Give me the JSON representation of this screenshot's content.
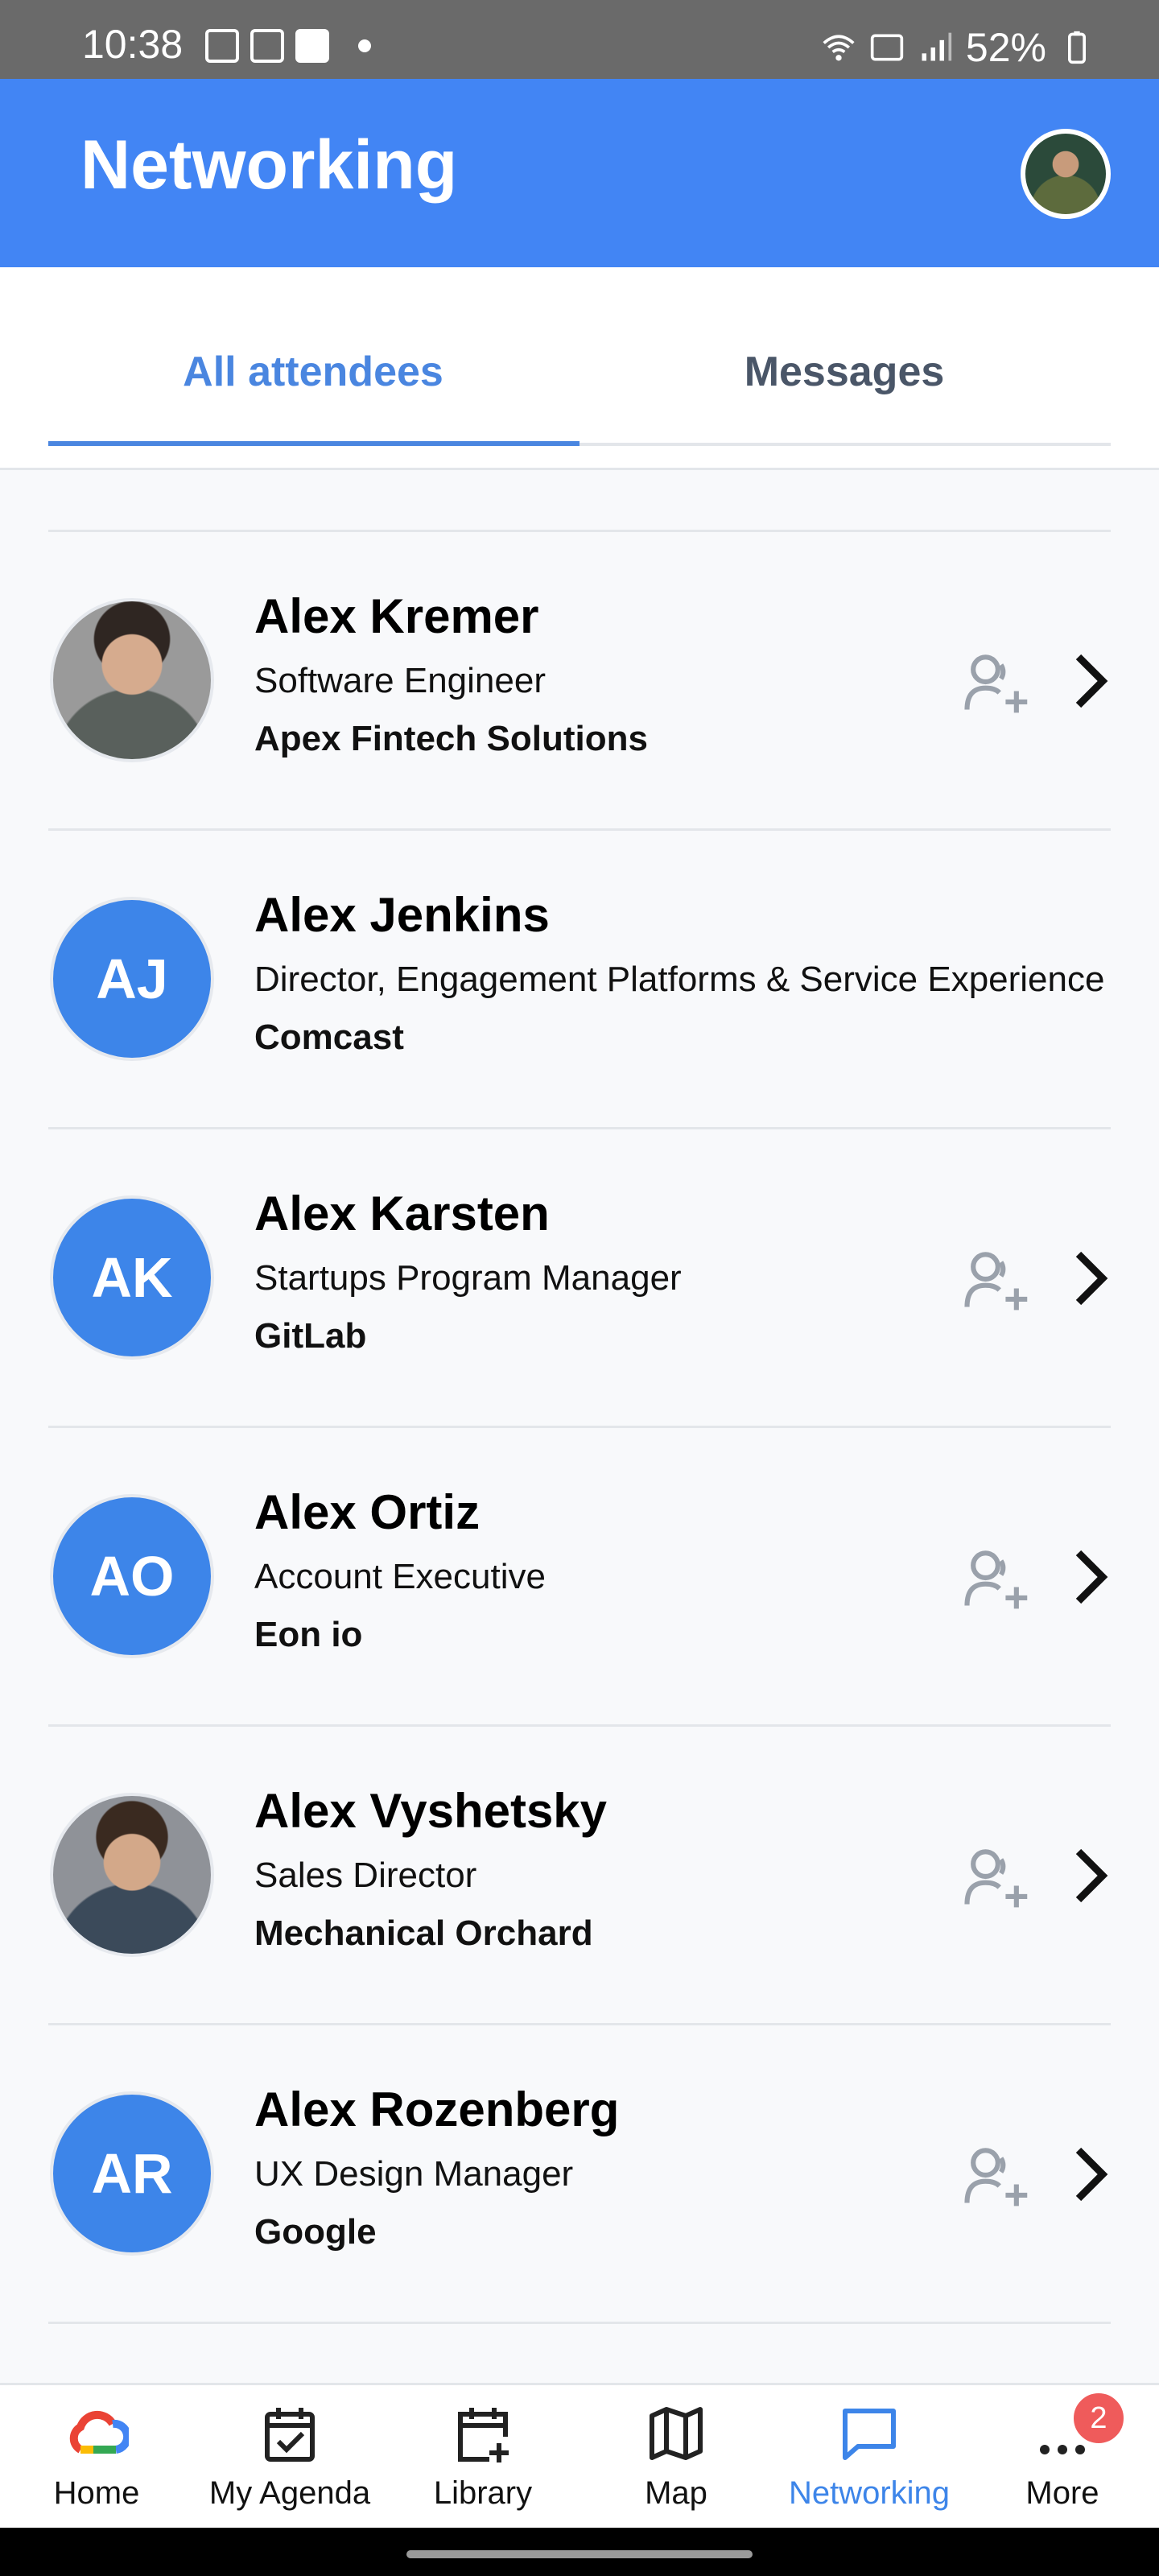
{
  "status_bar": {
    "time": "10:38",
    "battery": "52%"
  },
  "header": {
    "title": "Networking"
  },
  "tabs": [
    {
      "label": "All attendees",
      "active": true
    },
    {
      "label": "Messages",
      "active": false
    }
  ],
  "attendees": [
    {
      "name": "Alex Kremer",
      "title": "Software Engineer",
      "company": "Apex Fintech Solutions",
      "initials": "",
      "has_photo": true,
      "can_connect": true
    },
    {
      "name": "Alex Jenkins",
      "title": "Director, Engagement Platforms & Service Experience",
      "company": "Comcast",
      "initials": "AJ",
      "has_photo": false,
      "can_connect": false
    },
    {
      "name": "Alex Karsten",
      "title": "Startups Program Manager",
      "company": "GitLab",
      "initials": "AK",
      "has_photo": false,
      "can_connect": true
    },
    {
      "name": "Alex Ortiz",
      "title": "Account Executive",
      "company": "Eon io",
      "initials": "AO",
      "has_photo": false,
      "can_connect": true
    },
    {
      "name": "Alex Vyshetsky",
      "title": "Sales Director",
      "company": "Mechanical Orchard",
      "initials": "",
      "has_photo": true,
      "can_connect": true
    },
    {
      "name": "Alex Rozenberg",
      "title": "UX Design Manager",
      "company": "Google",
      "initials": "AR",
      "has_photo": false,
      "can_connect": true
    }
  ],
  "bottom_nav": [
    {
      "label": "Home",
      "icon": "google-cloud-icon",
      "active": false
    },
    {
      "label": "My Agenda",
      "icon": "calendar-check-icon",
      "active": false
    },
    {
      "label": "Library",
      "icon": "calendar-add-icon",
      "active": false
    },
    {
      "label": "Map",
      "icon": "map-icon",
      "active": false
    },
    {
      "label": "Networking",
      "icon": "chat-icon",
      "active": true
    },
    {
      "label": "More",
      "icon": "more-dots-icon",
      "active": false,
      "badge": "2"
    }
  ],
  "colors": {
    "accent": "#4285f4",
    "avatar_blue": "#3d85e9",
    "badge_red": "#ef5b5b"
  }
}
